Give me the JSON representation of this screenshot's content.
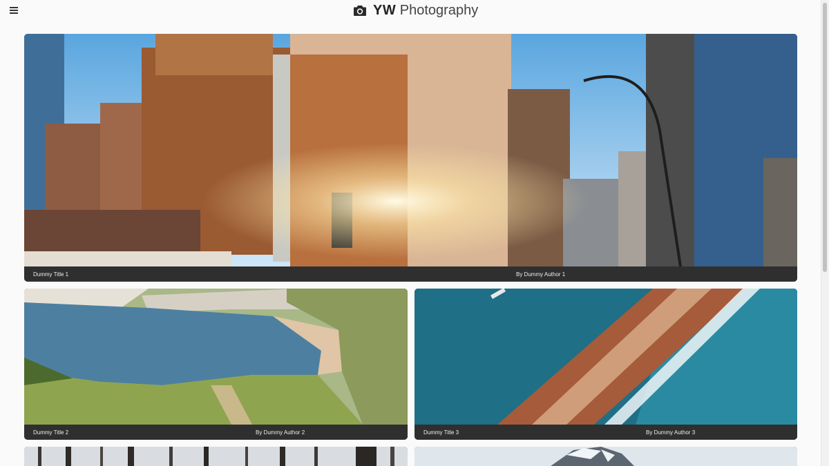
{
  "header": {
    "brand_bold": "YW",
    "brand_light": "Photography",
    "menu_icon": "hamburger-menu-icon",
    "logo_icon": "camera-icon"
  },
  "cards": [
    {
      "title": "Dummy Title 1",
      "author": "By Dummy Author 1",
      "image": "city-street-photo"
    },
    {
      "title": "Dummy Title 2",
      "author": "By Dummy Author 2",
      "image": "coastal-cove-photo"
    },
    {
      "title": "Dummy Title 3",
      "author": "By Dummy Author 3",
      "image": "aerial-breakwater-photo"
    },
    {
      "image": "winter-forest-photo"
    },
    {
      "image": "snowy-mountain-photo"
    }
  ],
  "colors": {
    "background": "#fafafa",
    "caption_bar": "#2f2f2f",
    "caption_text": "#eeeeee"
  }
}
